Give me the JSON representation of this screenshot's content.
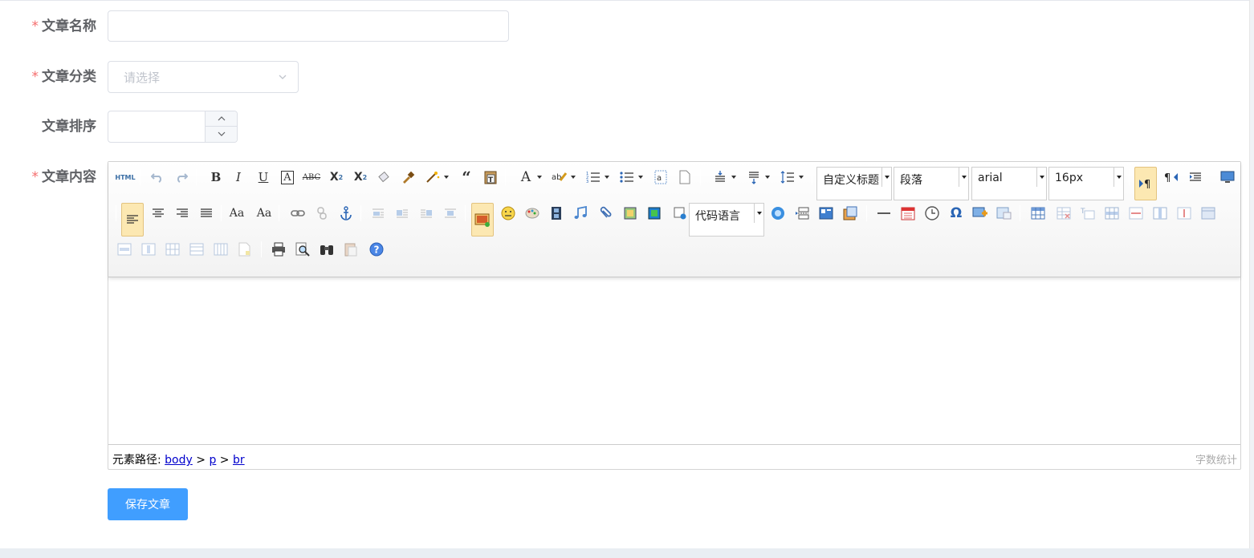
{
  "form": {
    "name_label": "文章名称",
    "category_label": "文章分类",
    "category_placeholder": "请选择",
    "order_label": "文章排序",
    "content_label": "文章内容",
    "required_mark": "*"
  },
  "editor": {
    "html_label": "HTML",
    "combos": {
      "custom_heading": "自定义标题",
      "paragraph": "段落",
      "font_family": "arial",
      "font_size": "16px",
      "code_language": "代码语言"
    },
    "statusbar": {
      "path_label": "元素路径:",
      "path": [
        "body",
        "p",
        "br"
      ],
      "path_sep": " > ",
      "word_count": "字数统计"
    }
  },
  "actions": {
    "save_label": "保存文章"
  },
  "colors": {
    "primary": "#409eff",
    "required": "#f56c6c",
    "label": "#606266"
  }
}
